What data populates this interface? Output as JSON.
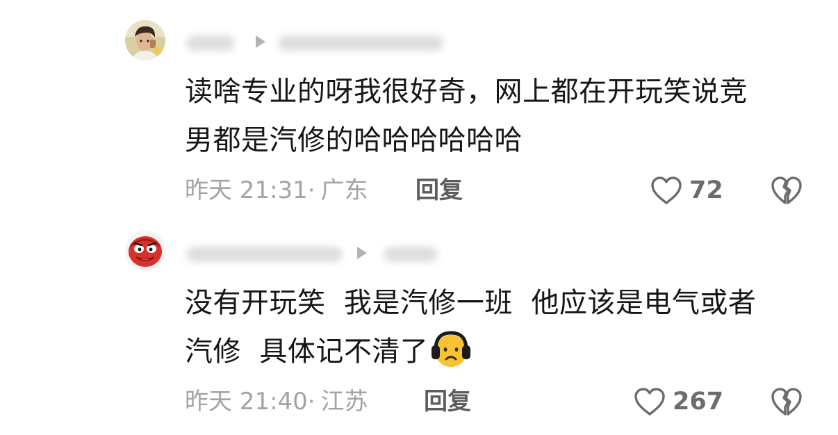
{
  "comments": [
    {
      "avatar": "avatar-boy-photo",
      "text_line1": "读啥专业的呀我很好奇，网上都在开玩笑说竞",
      "text_line2": "男都是汽修的哈哈哈哈哈哈",
      "time": "昨天 21:31",
      "location_sep": "·",
      "location": "广东",
      "reply_label": "回复",
      "likes": "72",
      "like_icon": "heart-outline-icon",
      "dislike_icon": "broken-heart-icon"
    },
    {
      "avatar": "avatar-red-mask-cartoon",
      "text_line1": "没有开玩笑  我是汽修一班  他应该是电气或者",
      "text_line2": "汽修  具体记不清了",
      "emoji": "sad-face-with-headphones-emoji",
      "time": "昨天 21:40",
      "location_sep": "·",
      "location": "江苏",
      "reply_label": "回复",
      "likes": "267",
      "like_icon": "heart-outline-icon",
      "dislike_icon": "broken-heart-icon"
    }
  ],
  "colors": {
    "text": "#161616",
    "meta": "#a3a3a3",
    "reply": "#5c5c5c",
    "icon": "#6c6c6c"
  }
}
